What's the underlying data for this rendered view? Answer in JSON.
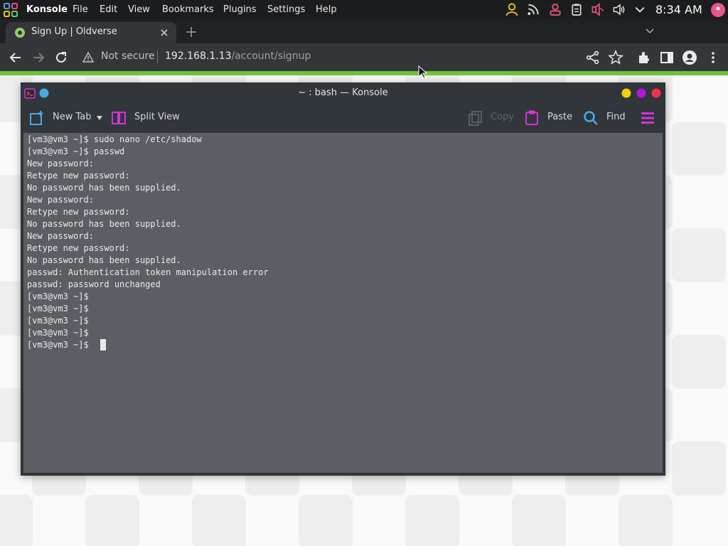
{
  "panel": {
    "app_name": "Konsole",
    "menus": [
      "File",
      "Edit",
      "View",
      "Bookmarks",
      "Plugins",
      "Settings",
      "Help"
    ],
    "clock": "8:34 AM",
    "tray_icons": [
      "user-icon",
      "rss-icon",
      "account-icon",
      "clipboard-icon",
      "microphone-muted-icon",
      "volume-icon",
      "chevron-down-icon"
    ]
  },
  "browser": {
    "tab_title": "Sign Up | Oldverse",
    "address": {
      "security": "Not secure",
      "host": "192.168.1.13",
      "path": "/account/signup"
    }
  },
  "konsole": {
    "title": "~ : bash — Konsole",
    "toolbar": {
      "new_tab": "New Tab",
      "split_view": "Split View",
      "copy": "Copy",
      "paste": "Paste",
      "find": "Find"
    },
    "lines": [
      "[vm3@vm3 ~]$ sudo nano /etc/shadow",
      "[vm3@vm3 ~]$ passwd",
      "New password:",
      "Retype new password:",
      "No password has been supplied.",
      "New password:",
      "Retype new password:",
      "No password has been supplied.",
      "New password:",
      "Retype new password:",
      "No password has been supplied.",
      "passwd: Authentication token manipulation error",
      "passwd: password unchanged",
      "[vm3@vm3 ~]$",
      "[vm3@vm3 ~]$",
      "[vm3@vm3 ~]$",
      "[vm3@vm3 ~]$",
      "[vm3@vm3 ~]$"
    ]
  },
  "colors": {
    "accent_green": "#6cc33a",
    "konsole_accent": "#d633d6",
    "terminal_bg": "#5b5e63"
  }
}
